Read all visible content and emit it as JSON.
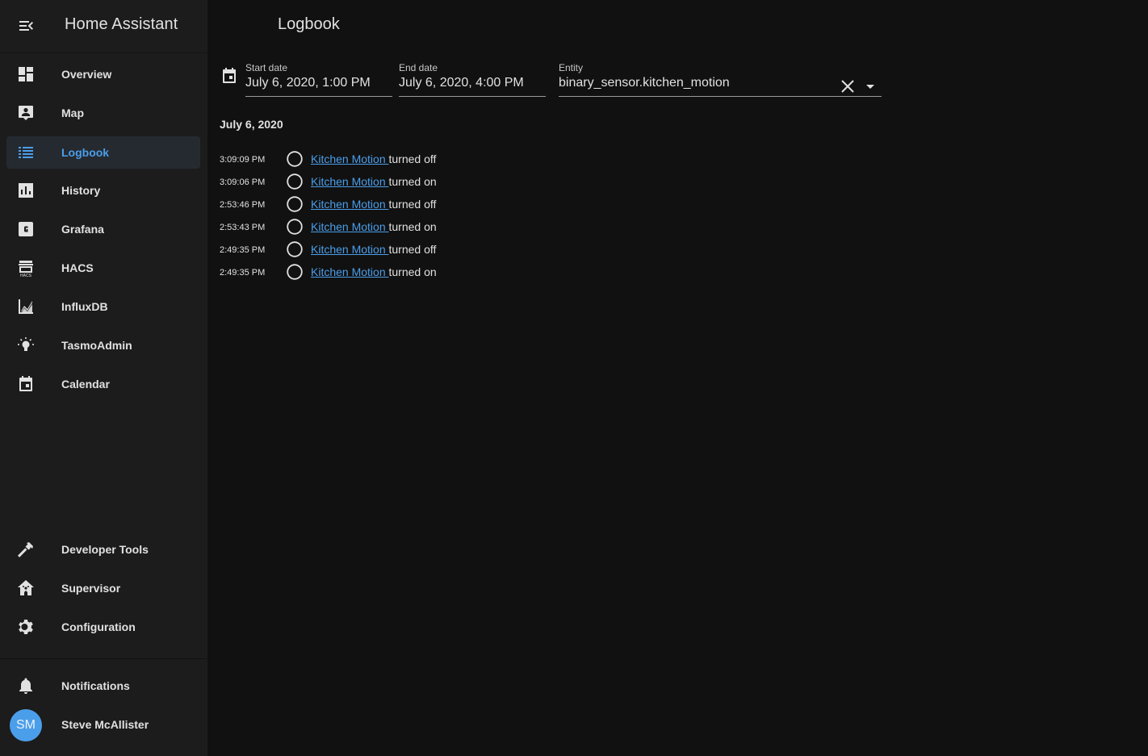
{
  "sidebar": {
    "app_title": "Home Assistant",
    "items": [
      {
        "label": "Overview",
        "icon": "dashboard-icon"
      },
      {
        "label": "Map",
        "icon": "map-account-icon"
      },
      {
        "label": "Logbook",
        "icon": "format-list-bulleted-icon",
        "active": true
      },
      {
        "label": "History",
        "icon": "chart-box-icon"
      },
      {
        "label": "Grafana",
        "icon": "grafana-icon"
      },
      {
        "label": "HACS",
        "icon": "hacs-store-icon"
      },
      {
        "label": "InfluxDB",
        "icon": "chart-areaspline-icon"
      },
      {
        "label": "TasmoAdmin",
        "icon": "lightbulb-on-icon"
      },
      {
        "label": "Calendar",
        "icon": "calendar-icon"
      }
    ],
    "bottom_items": [
      {
        "label": "Developer Tools",
        "icon": "hammer-icon"
      },
      {
        "label": "Supervisor",
        "icon": "home-assistant-icon"
      },
      {
        "label": "Configuration",
        "icon": "cog-icon"
      }
    ],
    "notifications_label": "Notifications",
    "user": {
      "name": "Steve McAllister",
      "initials": "SM"
    }
  },
  "header": {
    "title": "Logbook"
  },
  "filters": {
    "start_label": "Start date",
    "start_value": "July 6, 2020, 1:00 PM",
    "end_label": "End date",
    "end_value": "July 6, 2020, 4:00 PM",
    "entity_label": "Entity",
    "entity_value": "binary_sensor.kitchen_motion"
  },
  "logbook": {
    "date_heading": "July 6, 2020",
    "entries": [
      {
        "time": "3:09:09 PM",
        "entity": "Kitchen Motion ",
        "action": "turned off"
      },
      {
        "time": "3:09:06 PM",
        "entity": "Kitchen Motion ",
        "action": "turned on"
      },
      {
        "time": "2:53:46 PM",
        "entity": "Kitchen Motion ",
        "action": "turned off"
      },
      {
        "time": "2:53:43 PM",
        "entity": "Kitchen Motion ",
        "action": "turned on"
      },
      {
        "time": "2:49:35 PM",
        "entity": "Kitchen Motion ",
        "action": "turned off"
      },
      {
        "time": "2:49:35 PM",
        "entity": "Kitchen Motion ",
        "action": "turned on"
      }
    ]
  },
  "colors": {
    "accent": "#4b9eea",
    "sidebar_bg": "#1c1c1c",
    "main_bg": "#111111",
    "active_item_bg": "#252a30"
  }
}
